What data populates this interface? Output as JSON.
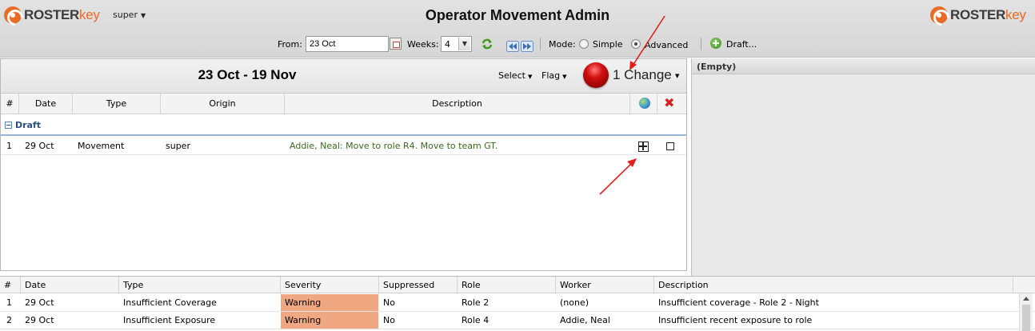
{
  "header": {
    "logo_left": {
      "part1": "ROSTER",
      "part2": "key"
    },
    "logo_right": {
      "part1": "ROSTER",
      "part2": "key"
    },
    "user": "super",
    "title": "Operator Movement Admin"
  },
  "toolbar": {
    "from_label": "From:",
    "from_value": "23 Oct",
    "weeks_label": "Weeks:",
    "weeks_value": "4",
    "mode_label": "Mode:",
    "mode_simple": "Simple",
    "mode_advanced": "Advanced",
    "mode_selected": "Advanced",
    "draft_label": "Draft..."
  },
  "main": {
    "range_title": "23 Oct - 19 Nov",
    "select_menu": "Select",
    "flag_menu": "Flag",
    "change_label": "1 Change",
    "columns": [
      "#",
      "Date",
      "Type",
      "Origin",
      "Description"
    ],
    "group_label": "Draft",
    "rows": [
      {
        "num": "1",
        "date": "29 Oct",
        "type": "Movement",
        "origin": "super",
        "description": "Addie, Neal: Move to role R4. Move to team GT."
      }
    ]
  },
  "side": {
    "title": "(Empty)"
  },
  "bottom": {
    "columns": [
      "#",
      "Date",
      "Type",
      "Severity",
      "Suppressed",
      "Role",
      "Worker",
      "Description"
    ],
    "rows": [
      {
        "num": "1",
        "date": "29 Oct",
        "type": "Insufficient Coverage",
        "severity": "Warning",
        "suppressed": "No",
        "role": "Role 2",
        "worker": "(none)",
        "description": "Insufficient coverage - Role 2 - Night"
      },
      {
        "num": "2",
        "date": "29 Oct",
        "type": "Insufficient Exposure",
        "severity": "Warning",
        "suppressed": "No",
        "role": "Role 4",
        "worker": "Addie, Neal",
        "description": "Insufficient recent exposure to role"
      }
    ]
  },
  "colors": {
    "brand_orange": "#ea6b26",
    "warning": "#f0a882",
    "group_blue": "#2b4f80",
    "change_red": "#d01010",
    "annotation_red": "#e0201f"
  }
}
